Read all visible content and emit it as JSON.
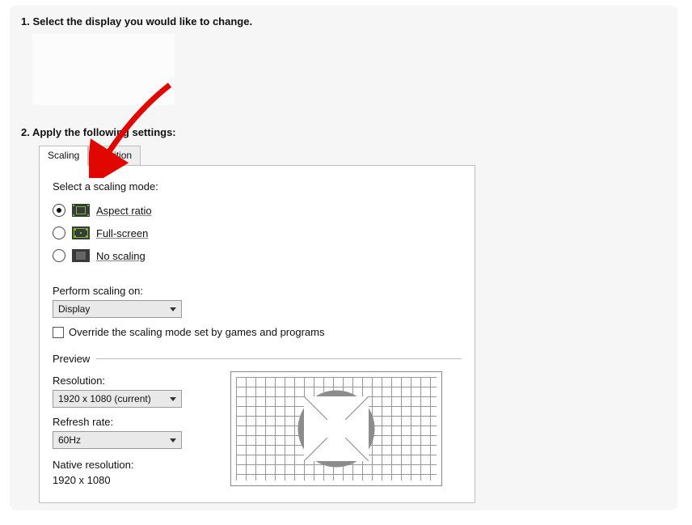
{
  "step1": {
    "heading": "1. Select the display you would like to change."
  },
  "step2": {
    "heading": "2. Apply the following settings:"
  },
  "tabs": {
    "scaling": "Scaling",
    "position": "Position"
  },
  "scaling": {
    "mode_label": "Select a scaling mode:",
    "options": {
      "aspect": "Aspect ratio",
      "full": "Full-screen",
      "none": "No scaling"
    },
    "perform_label": "Perform scaling on:",
    "perform_value": "Display",
    "override_label": "Override the scaling mode set by games and programs"
  },
  "preview": {
    "heading": "Preview",
    "resolution_label": "Resolution:",
    "resolution_value": "1920 x 1080 (current)",
    "refresh_label": "Refresh rate:",
    "refresh_value": "60Hz",
    "native_label": "Native resolution:",
    "native_value": "1920 x 1080"
  },
  "colors": {
    "arrow": "#e10600"
  }
}
